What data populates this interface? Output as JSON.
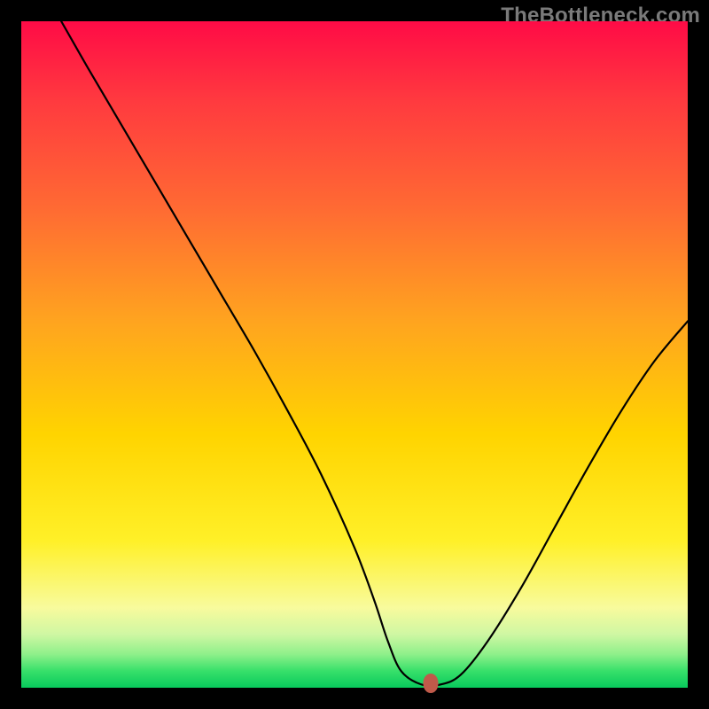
{
  "watermark": "TheBottleneck.com",
  "chart_data": {
    "type": "line",
    "title": "",
    "xlabel": "",
    "ylabel": "",
    "xlim": [
      0,
      100
    ],
    "ylim": [
      0,
      100
    ],
    "grid": false,
    "legend": false,
    "series": [
      {
        "name": "bottleneck-curve",
        "x": [
          6,
          10,
          15,
          20,
          25,
          30,
          35,
          40,
          45,
          50,
          53,
          55,
          57,
          60,
          63,
          66,
          70,
          75,
          80,
          85,
          90,
          95,
          100
        ],
        "y": [
          100,
          93,
          84.5,
          76,
          67.5,
          59,
          50.5,
          41.5,
          32,
          21,
          13,
          7,
          2.5,
          0.5,
          0.5,
          2,
          7,
          15,
          24,
          33,
          41.5,
          49,
          55
        ]
      }
    ],
    "marker": {
      "x": 61.5,
      "y": 0.6
    },
    "background_gradient_note": "vertical heat gradient red→yellow→green (bottleneck heatmap backdrop)"
  }
}
